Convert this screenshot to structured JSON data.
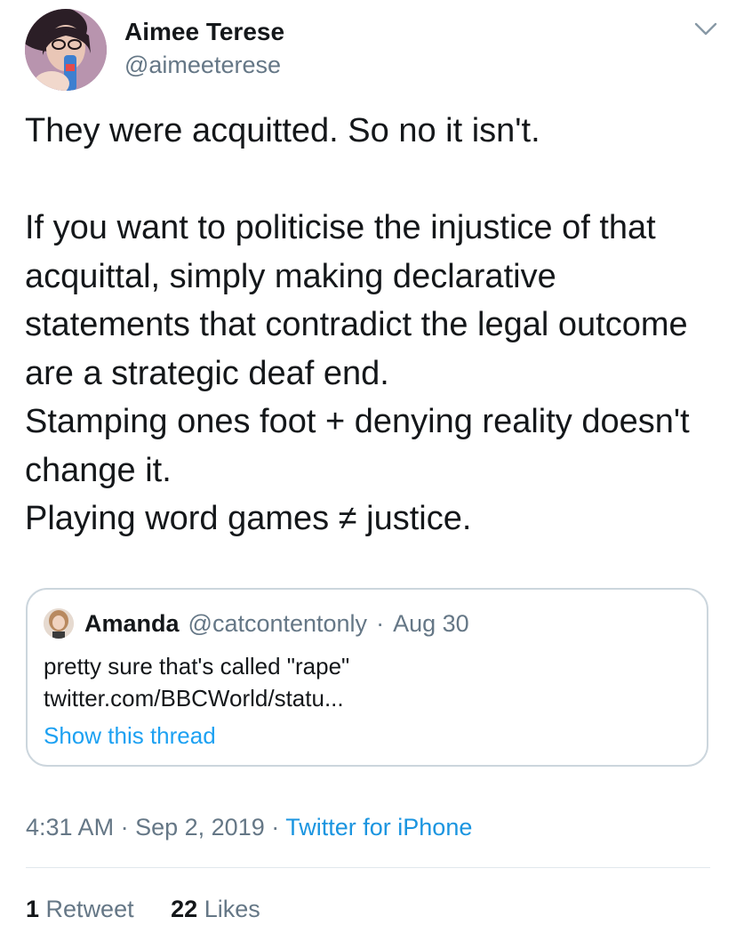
{
  "author": {
    "display_name": "Aimee Terese",
    "handle": "@aimeeterese"
  },
  "tweet": {
    "text": "They were acquitted. So no it isn't.\n\nIf you want to politicise the injustice of that acquittal, simply making declarative statements that contradict the legal outcome are a strategic deaf end.\nStamping ones foot + denying reality doesn't change it.\nPlaying word games ≠ justice."
  },
  "quoted_tweet": {
    "display_name": "Amanda",
    "handle": "@catcontentonly",
    "separator": "·",
    "date": "Aug 30",
    "line1": "pretty sure that's called \"rape\"",
    "line2": "twitter.com/BBCWorld/statu...",
    "show_thread": "Show this thread"
  },
  "meta": {
    "time": "4:31 AM",
    "separator": "·",
    "date": "Sep 2, 2019",
    "source": "Twitter for iPhone"
  },
  "stats": {
    "retweets_count": "1",
    "retweets_label": "Retweet",
    "likes_count": "22",
    "likes_label": "Likes"
  },
  "colors": {
    "link": "#1da1f2",
    "muted": "#657786",
    "text": "#14171a",
    "border": "#ccd6dd"
  },
  "icons": {
    "more": "chevron-down-icon"
  }
}
